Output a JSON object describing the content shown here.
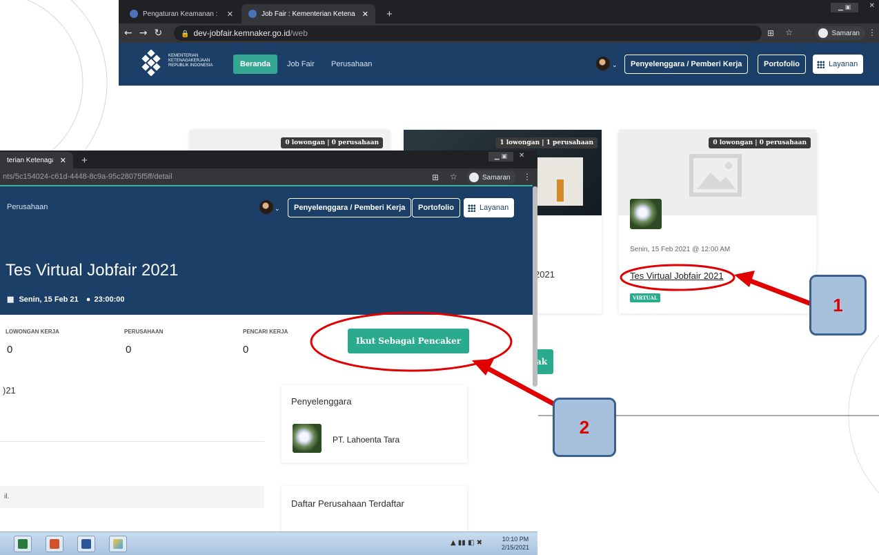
{
  "back_window": {
    "tabs": [
      "Pengaturan Keamanan : Kementr",
      "Job Fair : Kementerian Ketenagal"
    ],
    "url_host": "dev-jobfair.kemnaker.go.id",
    "url_path": "/web",
    "profile_label": "Samaran",
    "logo_text": "KEMENTERIAN KETENAGAKERJAAN REPUBLIK INDONESIA",
    "nav": {
      "home": "Beranda",
      "jobfair": "Job Fair",
      "company": "Perusahaan"
    },
    "buttons": {
      "organizer": "Penyelenggara / Pemberi Kerja",
      "portfolio": "Portofolio",
      "services": "Layanan"
    }
  },
  "cards": [
    {
      "badge": "0 lowongan | 0 perusahaan"
    },
    {
      "badge": "1 lowongan | 1 perusahaan",
      "title_fragment": "2021"
    },
    {
      "badge": "0 lowongan | 0 perusahaan",
      "date": "Senin, 15 Feb 2021 @ 12:00 AM",
      "title": "Tes Virtual Jobfair 2021",
      "tag": "VIRTUAL"
    }
  ],
  "behind_button_fragment": "ak",
  "front_window": {
    "tab": "terian Ketenagal",
    "url": "nts/5c154024-c61d-4448-8c9a-95c28075f5ff/detail",
    "profile_label": "Samaran",
    "nav": {
      "company": "Perusahaan"
    },
    "buttons": {
      "organizer": "Penyelenggara / Pemberi Kerja",
      "portfolio": "Portofolio",
      "services": "Layanan"
    },
    "title": "Tes Virtual Jobfair 2021",
    "date": "Senin, 15 Feb 21",
    "time": "23:00:00",
    "stats": [
      {
        "label": "LOWONGAN KERJA",
        "value": "0"
      },
      {
        "label": "PERUSAHAAN",
        "value": "0"
      },
      {
        "label": "PENCARI KERJA",
        "value": "0"
      }
    ],
    "join_button": "Ikut Sebagai Pencaker",
    "left_fragment_1": ")21",
    "left_fragment_2": "il.",
    "organizer_heading": "Penyelenggara",
    "organizer_name": "PT. Lahoenta Tara",
    "companies_heading": "Daftar Perusahaan Terdaftar"
  },
  "taskbar": {
    "time": "10:10 PM",
    "date": "2/15/2021"
  },
  "callouts": [
    "1",
    "2"
  ],
  "colors": {
    "navy": "#1b3f66",
    "green": "#2bab8e",
    "annotation_red": "#e00000",
    "callout_fill": "#a7c0dc"
  }
}
